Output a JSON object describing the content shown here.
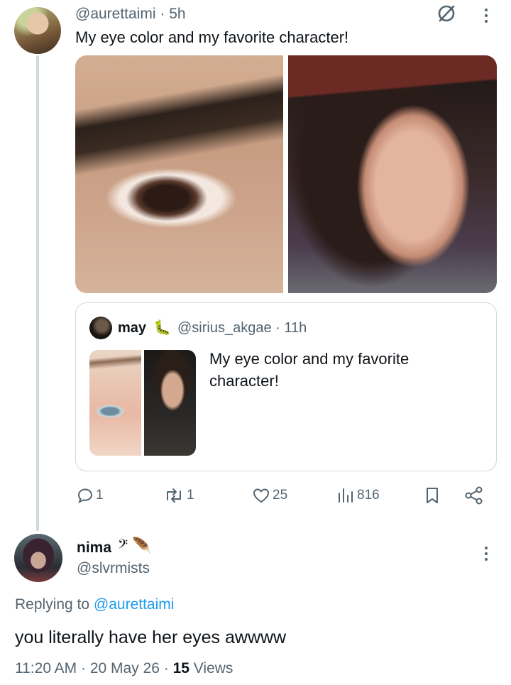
{
  "original_tweet": {
    "handle": "@aurettaimi",
    "time": "5h",
    "text": "My eye color and my favorite character!",
    "icons": [
      "circle-slash-icon",
      "more-vertical-icon"
    ]
  },
  "quoted_tweet": {
    "name": "may",
    "emoji": "🐛",
    "handle": "@sirius_akgae",
    "time": "11h",
    "text": "My eye color and my favorite character!"
  },
  "actions": {
    "replies": "1",
    "retweets": "1",
    "likes": "25",
    "views": "816"
  },
  "reply": {
    "name": "nima",
    "name_emoji": "𝄢 🪶",
    "handle": "@slvrmists",
    "replying_to_label": "Replying to",
    "replying_to_handle": "@aurettaimi",
    "text": "you literally have her eyes awwww",
    "time": "11:20 AM",
    "date": "20 May 26",
    "views_count": "15",
    "views_label": "Views"
  },
  "colors": {
    "text": "#0f1419",
    "secondary": "#536471",
    "accent": "#1d9bf0",
    "border": "#cfd9de"
  }
}
